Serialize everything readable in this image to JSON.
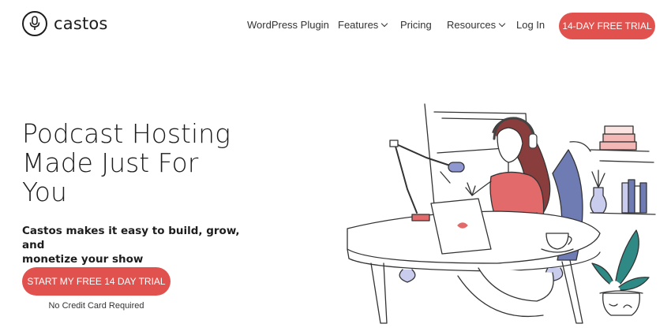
{
  "brand": {
    "name": "castos",
    "logo_icon": "microphone-icon"
  },
  "nav": {
    "items": [
      {
        "label": "WordPress Plugin"
      },
      {
        "label": "Features",
        "dropdown": true
      },
      {
        "label": "Pricing"
      },
      {
        "label": "Resources",
        "dropdown": true
      },
      {
        "label": "Log In"
      }
    ],
    "cta": "14-DAY FREE TRIAL"
  },
  "hero": {
    "title_lines": [
      "Podcast Hosting",
      "Made Just For",
      "You"
    ],
    "subtitle_lines": [
      "Castos makes it easy to build, grow, and",
      "monetize your show"
    ],
    "cta": "START MY FREE 14 DAY TRIAL",
    "cta_note": "No Credit Card Required"
  },
  "colors": {
    "accent": "#e1524f",
    "text": "#1d1d1d",
    "illustration_shirt": "#e36a6a",
    "illustration_chair": "#6f7bb3",
    "illustration_plant": "#2f8a86"
  }
}
